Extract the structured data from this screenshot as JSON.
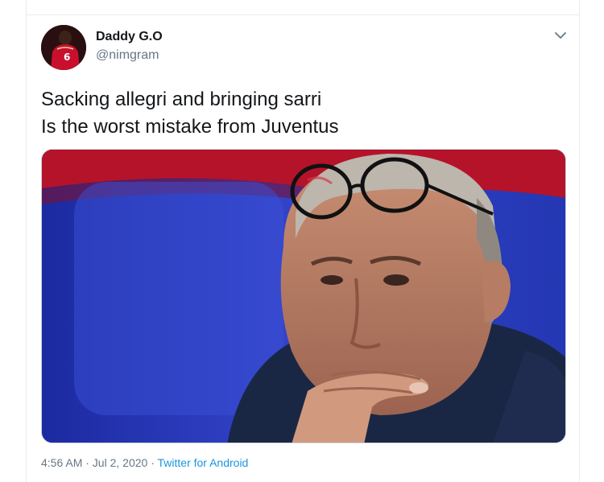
{
  "tweet": {
    "display_name": "Daddy G.O",
    "handle": "@nimgram",
    "avatar_jersey_number": "6",
    "lines": [
      "Sacking allegri and bringing sarri",
      "Is the worst mistake from Juventus"
    ],
    "menu_icon": "chevron-down-icon",
    "timestamp": "4:56 AM · Jul 2, 2020",
    "source": "Twitter for Android"
  },
  "colors": {
    "handle_gray": "#657786",
    "link_blue": "#1b95e0",
    "border": "#e6ecf0"
  }
}
